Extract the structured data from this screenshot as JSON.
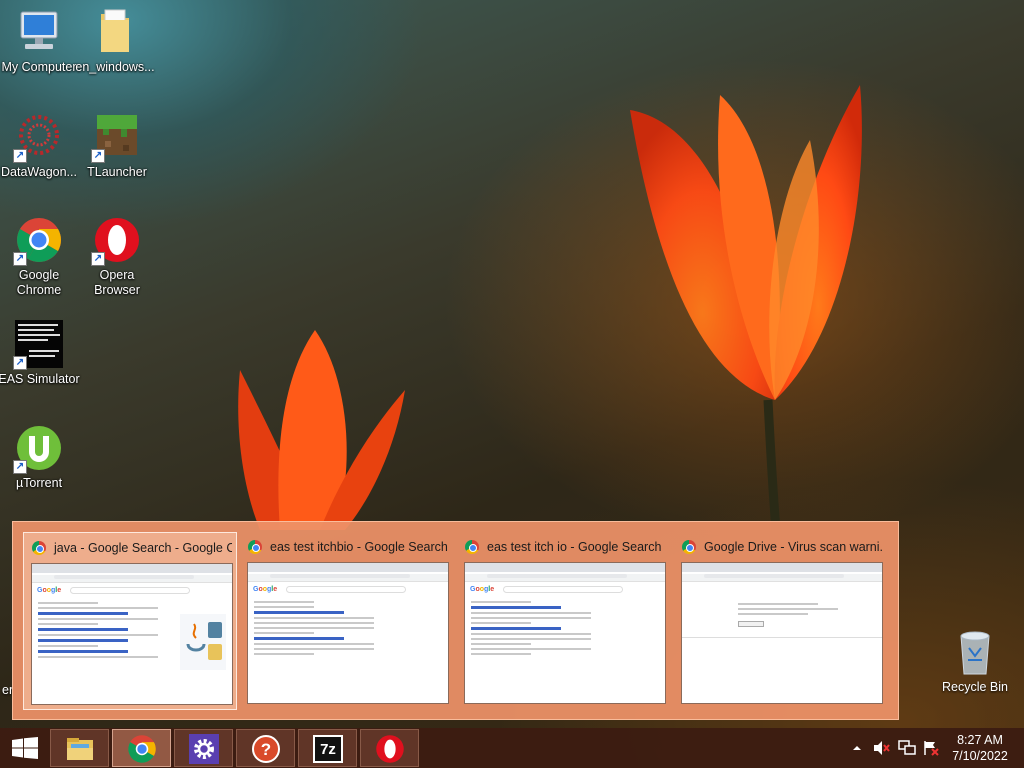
{
  "desktop": {
    "icons": [
      {
        "label": "My Computer",
        "icon": "computer-icon"
      },
      {
        "label": "en_windows...",
        "icon": "folder-icon"
      },
      {
        "label": "DataWagon...",
        "icon": "datawagon-icon"
      },
      {
        "label": "TLauncher",
        "icon": "tlauncher-icon"
      },
      {
        "label": "Google Chrome",
        "icon": "chrome-icon"
      },
      {
        "label": "Opera Browser",
        "icon": "opera-icon"
      },
      {
        "label": "EAS Simulator",
        "icon": "eas-simulator-icon"
      },
      {
        "label": "µTorrent",
        "icon": "utorrent-icon"
      }
    ],
    "recycle_bin": "Recycle Bin",
    "partial_label": "er"
  },
  "thumbnails": [
    {
      "title": "java - Google Search - Google C...",
      "active": true
    },
    {
      "title": "eas test itchbio - Google Search ...",
      "active": false
    },
    {
      "title": "eas test itch io - Google Search ...",
      "active": false
    },
    {
      "title": "Google Drive - Virus scan warni...",
      "active": false
    }
  ],
  "taskbar": {
    "buttons": [
      {
        "name": "file-explorer",
        "icon": "folder-icon"
      },
      {
        "name": "google-chrome",
        "icon": "chrome-icon",
        "active": true
      },
      {
        "name": "settings",
        "icon": "gear-icon"
      },
      {
        "name": "help",
        "icon": "help-icon"
      },
      {
        "name": "7zip",
        "icon": "7zip-icon",
        "text": "7z"
      },
      {
        "name": "opera",
        "icon": "opera-icon"
      }
    ],
    "tray": {
      "icons": [
        "chevron-up-icon",
        "volume-muted-icon",
        "network-icon",
        "action-center-icon"
      ]
    },
    "clock": {
      "time": "8:27 AM",
      "date": "7/10/2022"
    }
  },
  "colors": {
    "taskbar": "#3c1c12",
    "thumb_strip": "#ee9268",
    "tulip": "#ff4a14"
  }
}
